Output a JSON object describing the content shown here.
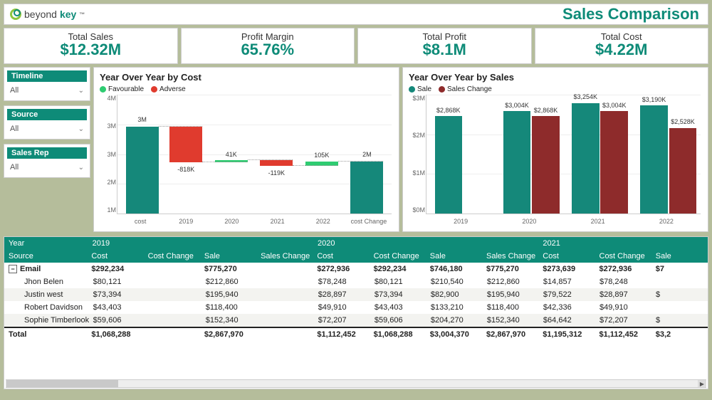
{
  "header": {
    "brand_a": "beyond",
    "brand_b": "key",
    "tm": "™",
    "title": "Sales Comparison"
  },
  "kpis": [
    {
      "label": "Total Sales",
      "value": "$12.32M"
    },
    {
      "label": "Profit Margin",
      "value": "65.76%"
    },
    {
      "label": "Total Profit",
      "value": "$8.1M"
    },
    {
      "label": "Total Cost",
      "value": "$4.22M"
    }
  ],
  "filters": [
    {
      "label": "Timeline",
      "value": "All"
    },
    {
      "label": "Source",
      "value": "All"
    },
    {
      "label": "Sales Rep",
      "value": "All"
    }
  ],
  "cost_chart": {
    "title": "Year Over Year by Cost",
    "legend": {
      "favourable": "Favourable",
      "adverse": "Adverse"
    },
    "yticks": [
      "4M",
      "3M",
      "3M",
      "2M",
      "1M"
    ],
    "categories": [
      "cost",
      "2019",
      "2020",
      "2021",
      "2022",
      "cost Change"
    ],
    "start": {
      "label": "3M"
    },
    "deltas": [
      "-818K",
      "41K",
      "-119K",
      "105K"
    ],
    "end": {
      "label": "2M"
    }
  },
  "sales_chart": {
    "title": "Year Over Year by Sales",
    "legend": {
      "sale": "Sale",
      "change": "Sales Change"
    },
    "yticks": [
      "$3M",
      "$2M",
      "$1M",
      "$0M"
    ],
    "categories": [
      "2019",
      "2020",
      "2021",
      "2022"
    ],
    "labels_sale": [
      "$2,868K",
      "$3,004K",
      "$3,254K",
      "$3,190K"
    ],
    "labels_change": [
      "",
      "$2,868K",
      "$3,004K",
      "$2,528K"
    ]
  },
  "matrix": {
    "years": [
      "2019",
      "2020",
      "2021"
    ],
    "row_headers": [
      "Year",
      "Source"
    ],
    "cols": [
      "Cost",
      "Cost Change",
      "Sale",
      "Sales Change",
      "Cost",
      "Cost Change",
      "Sale",
      "Sales Change",
      "Cost",
      "Cost Change",
      "Sale"
    ],
    "group": "Email",
    "group_row": [
      "$292,234",
      "",
      "$775,270",
      "",
      "$272,936",
      "$292,234",
      "$746,180",
      "$775,270",
      "$273,639",
      "$272,936",
      "$7"
    ],
    "rows": [
      {
        "name": "Jhon Belen",
        "v": [
          "$80,121",
          "",
          "$212,860",
          "",
          "$78,248",
          "$80,121",
          "$210,540",
          "$212,860",
          "$14,857",
          "$78,248",
          ""
        ]
      },
      {
        "name": "Justin west",
        "v": [
          "$73,394",
          "",
          "$195,940",
          "",
          "$28,897",
          "$73,394",
          "$82,900",
          "$195,940",
          "$79,522",
          "$28,897",
          "$"
        ]
      },
      {
        "name": "Robert Davidson",
        "v": [
          "$43,403",
          "",
          "$118,400",
          "",
          "$49,910",
          "$43,403",
          "$133,210",
          "$118,400",
          "$42,336",
          "$49,910",
          ""
        ]
      },
      {
        "name": "Sophie Timberlook",
        "v": [
          "$59,606",
          "",
          "$152,340",
          "",
          "$72,207",
          "$59,606",
          "$204,270",
          "$152,340",
          "$64,642",
          "$72,207",
          "$"
        ]
      }
    ],
    "total_label": "Total",
    "total": [
      "$1,068,288",
      "",
      "$2,867,970",
      "",
      "$1,112,452",
      "$1,068,288",
      "$3,004,370",
      "$2,867,970",
      "$1,195,312",
      "$1,112,452",
      "$3,2"
    ]
  },
  "chart_data": [
    {
      "type": "bar",
      "title": "Year Over Year by Cost",
      "subtype": "waterfall",
      "categories": [
        "cost",
        "2019",
        "2020",
        "2021",
        "2022",
        "cost Change"
      ],
      "values": [
        3000000,
        -818000,
        41000,
        -119000,
        105000,
        2200000
      ],
      "series_roles": [
        "start",
        "delta",
        "delta",
        "delta",
        "delta",
        "end"
      ],
      "value_labels": [
        "3M",
        "-818K",
        "41K",
        "-119K",
        "105K",
        "2M"
      ],
      "legend": [
        "Favourable",
        "Adverse"
      ],
      "ylim": [
        0,
        4000000
      ],
      "ylim_label": [
        "1M",
        "4M"
      ],
      "xlabel": "",
      "ylabel": ""
    },
    {
      "type": "bar",
      "title": "Year Over Year by Sales",
      "categories": [
        "2019",
        "2020",
        "2021",
        "2022"
      ],
      "series": [
        {
          "name": "Sale",
          "values": [
            2868000,
            3004000,
            3254000,
            3190000
          ]
        },
        {
          "name": "Sales Change",
          "values": [
            null,
            2868000,
            3004000,
            2528000
          ]
        }
      ],
      "value_labels": {
        "Sale": [
          "$2,868K",
          "$3,004K",
          "$3,254K",
          "$3,190K"
        ],
        "Sales Change": [
          "",
          "$2,868K",
          "$3,004K",
          "$2,528K"
        ]
      },
      "ylim": [
        0,
        3500000
      ],
      "ylabel": "",
      "xlabel": ""
    }
  ]
}
